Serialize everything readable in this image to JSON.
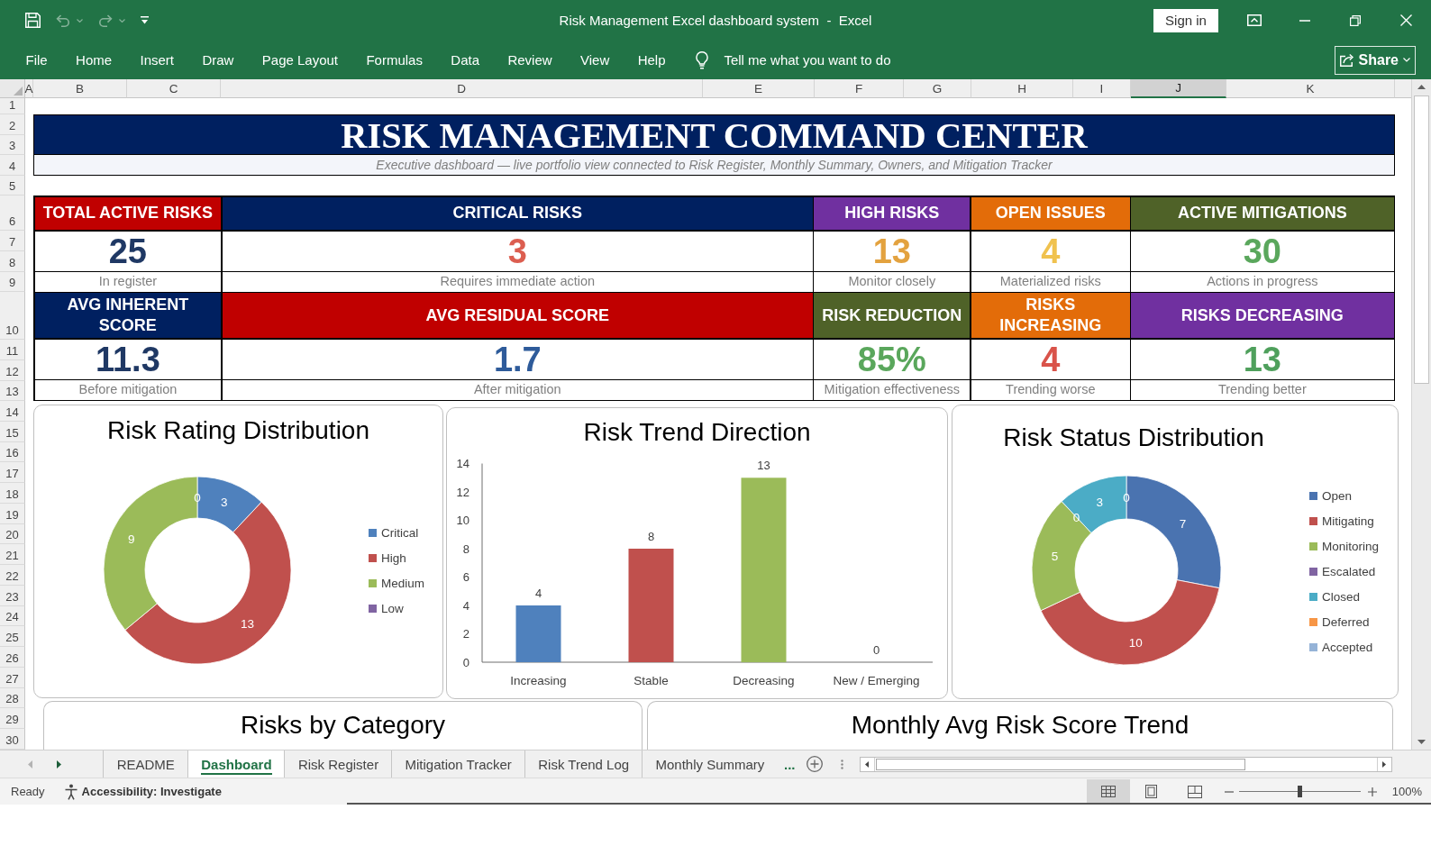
{
  "title_bar": {
    "quick_access": [
      {
        "kind": "save",
        "disabled": false
      },
      {
        "kind": "undo",
        "disabled": true
      },
      {
        "kind": "redo",
        "disabled": true
      },
      {
        "kind": "customize",
        "disabled": false
      }
    ],
    "title": "Risk Management Excel dashboard system  -  Excel",
    "sign_in": "Sign in"
  },
  "ribbon": {
    "tabs": [
      {
        "label": "File",
        "selected": false
      },
      {
        "label": "Home",
        "selected": false
      },
      {
        "label": "Insert",
        "selected": false
      },
      {
        "label": "Draw",
        "selected": false
      },
      {
        "label": "Page Layout",
        "selected": false
      },
      {
        "label": "Formulas",
        "selected": false
      },
      {
        "label": "Data",
        "selected": false
      },
      {
        "label": "Review",
        "selected": false
      },
      {
        "label": "View",
        "selected": false
      },
      {
        "label": "Help",
        "selected": false
      }
    ],
    "tell_me": {
      "placeholder": "Tell me what you want to do"
    },
    "share": "Share"
  },
  "sheet": {
    "columns": [
      {
        "label": "A",
        "selected": false
      },
      {
        "label": "B",
        "selected": false
      },
      {
        "label": "C",
        "selected": false
      },
      {
        "label": "D",
        "selected": false
      },
      {
        "label": "E",
        "selected": false
      },
      {
        "label": "F",
        "selected": false
      },
      {
        "label": "G",
        "selected": false
      },
      {
        "label": "H",
        "selected": false
      },
      {
        "label": "I",
        "selected": false
      },
      {
        "label": "J",
        "selected": true
      },
      {
        "label": "K",
        "selected": false
      }
    ],
    "rows": [
      "1",
      "2",
      "3",
      "4",
      "5",
      "6",
      "7",
      "8",
      "9",
      "10",
      "11",
      "12",
      "13",
      "14",
      "15",
      "16",
      "17",
      "18",
      "19",
      "20",
      "21",
      "22",
      "23",
      "24",
      "25",
      "26",
      "27",
      "28",
      "29",
      "30"
    ]
  },
  "dashboard": {
    "title": "RISK MANAGEMENT COMMAND CENTER",
    "subtitle": "Executive dashboard — live portfolio view connected to Risk Register, Monthly Summary, Owners, and Mitigation Tracker",
    "kpi_rows": [
      [
        {
          "label": "TOTAL ACTIVE RISKS",
          "color": "#c00000",
          "value": {
            "text": "25",
            "color": "#1f3864"
          },
          "note": "In register"
        },
        {
          "label": "CRITICAL RISKS",
          "color": "#002060",
          "value": {
            "text": "3",
            "color": "#dc5e50"
          },
          "note": "Requires immediate action"
        },
        {
          "label": "HIGH RISKS",
          "color": "#7030a0",
          "value": {
            "text": "13",
            "color": "#e3a23f"
          },
          "note": "Monitor closely"
        },
        {
          "label": "OPEN ISSUES",
          "color": "#e36c09",
          "value": {
            "text": "4",
            "color": "#f0c24e"
          },
          "note": "Materialized risks"
        },
        {
          "label": "ACTIVE MITIGATIONS",
          "color": "#4f6228",
          "value": {
            "text": "30",
            "color": "#5aa75c"
          },
          "note": "Actions in progress"
        }
      ],
      [
        {
          "label": "AVG INHERENT SCORE",
          "color": "#002060",
          "value": {
            "text": "11.3",
            "color": "#1f3864"
          },
          "note": "Before mitigation"
        },
        {
          "label": "AVG RESIDUAL SCORE",
          "color": "#c00000",
          "value": {
            "text": "1.7",
            "color": "#2e5b9a"
          },
          "note": "After mitigation"
        },
        {
          "label": "RISK REDUCTION",
          "color": "#4f6228",
          "value": {
            "text": "85%",
            "color": "#5aa75c"
          },
          "note": "Mitigation effectiveness"
        },
        {
          "label": "RISKS INCREASING",
          "color": "#e36c09",
          "value": {
            "text": "4",
            "color": "#d9534a"
          },
          "note": "Trending worse"
        },
        {
          "label": "RISKS DECREASING",
          "color": "#7030a0",
          "value": {
            "text": "13",
            "color": "#4fa05c"
          },
          "note": "Trending better"
        }
      ]
    ]
  },
  "charts": [
    {
      "chart_data": {
        "type": "donut",
        "title": "Risk Rating Distribution",
        "categories": [
          "Critical",
          "High",
          "Medium",
          "Low"
        ],
        "values": [
          3,
          13,
          9,
          0
        ],
        "colors": [
          "#4f81bd",
          "#c0504d",
          "#9bbb59",
          "#8064a2"
        ],
        "value_labels": [
          "3",
          "13",
          "9",
          "0"
        ],
        "legend": "right"
      }
    },
    {
      "chart_data": {
        "type": "bar",
        "title": "Risk Trend Direction",
        "categories": [
          "Increasing",
          "Stable",
          "Decreasing",
          "New / Emerging"
        ],
        "values": [
          4,
          8,
          13,
          0
        ],
        "colors": [
          "#4f81bd",
          "#c0504d",
          "#9bbb59",
          "#8064a2"
        ],
        "ylim": [
          0,
          14
        ],
        "yticks": [
          0,
          2,
          4,
          6,
          8,
          10,
          12,
          14
        ],
        "data_labels": true
      }
    },
    {
      "chart_data": {
        "type": "donut",
        "title": "Risk Status Distribution",
        "categories": [
          "Open",
          "Mitigating",
          "Monitoring",
          "Escalated",
          "Closed",
          "Deferred",
          "Accepted"
        ],
        "values": [
          7,
          10,
          5,
          0,
          3,
          0,
          0
        ],
        "colors": [
          "#4a73b0",
          "#c0504d",
          "#9bbb59",
          "#8064a2",
          "#4bacc6",
          "#f79646",
          "#95b3d7"
        ],
        "value_labels": [
          "7",
          "10",
          "5",
          "0",
          "3",
          null,
          "0"
        ],
        "legend": "right"
      }
    }
  ],
  "charts_below": [
    {
      "title": "Risks by Category"
    },
    {
      "title": "Monthly Avg Risk Score Trend"
    }
  ],
  "sheet_tabs": {
    "navigation": [
      {
        "kind": "previous",
        "disabled": true
      },
      {
        "kind": "next",
        "disabled": false
      }
    ],
    "tabs": [
      {
        "label": "README",
        "selected": false
      },
      {
        "label": "Dashboard",
        "selected": true
      },
      {
        "label": "Risk Register",
        "selected": false
      },
      {
        "label": "Mitigation Tracker",
        "selected": false
      },
      {
        "label": "Risk Trend Log",
        "selected": false
      },
      {
        "label": "Monthly Summary",
        "selected": false
      }
    ],
    "more": "..."
  },
  "status_bar": {
    "status": "Ready",
    "accessibility": "Accessibility: Investigate",
    "views": [
      {
        "kind": "normal",
        "selected": true
      },
      {
        "kind": "page_layout",
        "selected": false
      },
      {
        "kind": "page_break_preview",
        "selected": false
      }
    ],
    "zoom": {
      "level": 0.5,
      "reading": "100%"
    }
  }
}
